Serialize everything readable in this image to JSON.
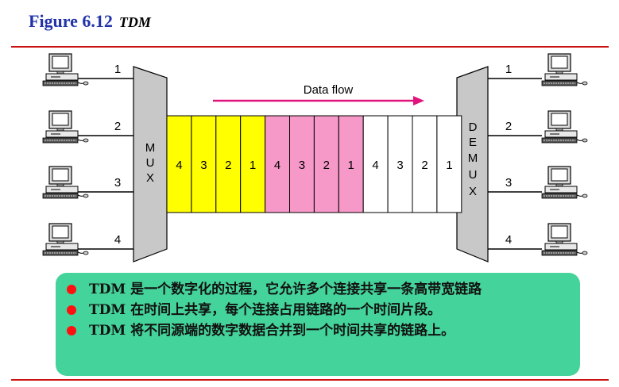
{
  "figure": {
    "number": "Figure 6.12",
    "name": "TDM"
  },
  "mux_letters": [
    "M",
    "U",
    "X"
  ],
  "demux_letters": [
    "D",
    "E",
    "M",
    "U",
    "X"
  ],
  "line_labels": [
    "1",
    "2",
    "3",
    "4"
  ],
  "flow_label": "Data flow",
  "frames": [
    {
      "color": "#ffff00",
      "slots": [
        "4",
        "3",
        "2",
        "1"
      ]
    },
    {
      "color": "#f799c8",
      "slots": [
        "4",
        "3",
        "2",
        "1"
      ]
    },
    {
      "color": "#ffffff",
      "slots": [
        "4",
        "3",
        "2",
        "1"
      ]
    }
  ],
  "colors": {
    "title": "#2233aa",
    "rule": "#cc1111",
    "arrow": "#e0147c",
    "panel": "#44d39a",
    "bullet": "#ff1010"
  },
  "bullets": [
    "TDM 是一个数字化的过程，它允许多个连接共享一条高带宽链路",
    "TDM 在时间上共享，每个连接占用链路的一个时间片段。",
    "TDM 将不同源端的数字数据合并到一个时间共享的链路上。"
  ]
}
